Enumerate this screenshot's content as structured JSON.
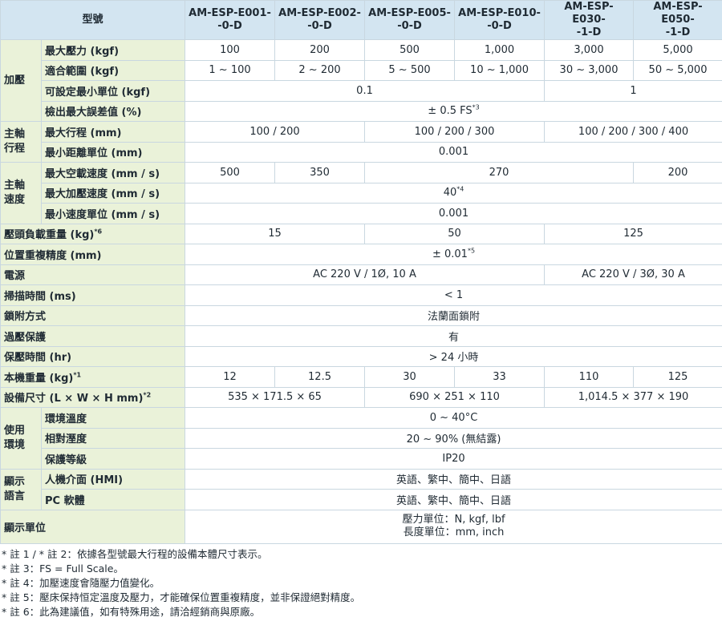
{
  "header": {
    "model_label": "型號",
    "models": [
      "AM-ESP-E001-\n-0-D",
      "AM-ESP-E002-\n-0-D",
      "AM-ESP-E005-\n-0-D",
      "AM-ESP-E010-\n-0-D",
      "AM-ESP-E030-\n-1-D",
      "AM-ESP-E050-\n-1-D"
    ]
  },
  "groups": {
    "pressure": "加壓",
    "stroke": "主軸\n行程",
    "speed": "主軸\n速度",
    "environment": "使用\n環境",
    "language": "顯示\n語言"
  },
  "rows": {
    "max_pressure": {
      "label": "最大壓力 (kgf)",
      "values": [
        "100",
        "200",
        "500",
        "1,000",
        "3,000",
        "5,000"
      ]
    },
    "range": {
      "label": "適合範圍 (kgf)",
      "values": [
        "1 ~ 100",
        "2 ~ 200",
        "5 ~ 500",
        "10 ~ 1,000",
        "30 ~ 3,000",
        "50 ~ 5,000"
      ]
    },
    "min_unit": {
      "label": "可設定最小單位 (kgf)",
      "values": [
        "0.1",
        "1"
      ]
    },
    "max_error": {
      "label": "檢出最大誤差值 (%)",
      "value": "± 0.5 FS",
      "sup": "*3"
    },
    "max_stroke": {
      "label": "最大行程 (mm)",
      "values": [
        "100 / 200",
        "100 / 200 / 300",
        "100 / 200 / 300 / 400"
      ]
    },
    "min_distance": {
      "label": "最小距離單位 (mm)",
      "value": "0.001"
    },
    "max_idle_speed": {
      "label": "最大空載速度 (mm / s)",
      "values": [
        "500",
        "350",
        "270",
        "200"
      ]
    },
    "max_press_speed": {
      "label": "最大加壓速度 (mm / s)",
      "value": "40",
      "sup": "*4"
    },
    "min_speed_unit": {
      "label": "最小速度單位 (mm / s)",
      "value": "0.001"
    },
    "head_load": {
      "label": "壓頭負載重量 (kg)",
      "label_sup": "*6",
      "values": [
        "15",
        "50",
        "125"
      ]
    },
    "repeatability": {
      "label": "位置重複精度 (mm)",
      "value": "± 0.01",
      "sup": "*5"
    },
    "power": {
      "label": "電源",
      "values": [
        "AC 220 V / 1Ø, 10 A",
        "AC 220 V / 3Ø, 30 A"
      ]
    },
    "scan_time": {
      "label": "掃描時間 (ms)",
      "value": "< 1"
    },
    "locking": {
      "label": "鎖附方式",
      "value": "法蘭面鎖附"
    },
    "overpressure": {
      "label": "過壓保護",
      "value": "有"
    },
    "hold_time": {
      "label": "保壓時間 (hr)",
      "value": "> 24 小時"
    },
    "weight": {
      "label": "本機重量 (kg)",
      "label_sup": "*1",
      "values": [
        "12",
        "12.5",
        "30",
        "33",
        "110",
        "125"
      ]
    },
    "dimensions": {
      "label": "設備尺寸 (L × W × H mm)",
      "label_sup": "*2",
      "values": [
        "535 × 171.5 × 65",
        "690 × 251 × 110",
        "1,014.5 × 377 × 190"
      ]
    },
    "env_temp": {
      "label": "環境溫度",
      "value": "0 ~ 40°C"
    },
    "humidity": {
      "label": "相對溼度",
      "value": "20 ~ 90% (無結露)"
    },
    "protection": {
      "label": "保護等級",
      "value": "IP20"
    },
    "hmi": {
      "label": "人機介面 (HMI)",
      "value": "英語、繁中、簡中、日語"
    },
    "pc_software": {
      "label": "PC 軟體",
      "value": "英語、繁中、簡中、日語"
    },
    "display_unit": {
      "label": "顯示單位",
      "value": "壓力單位：N, kgf, lbf\n長度單位：mm, inch"
    }
  },
  "notes": [
    "* 註 1 / * 註 2：依據各型號最大行程的設備本體尺寸表示。",
    "* 註 3：FS = Full Scale。",
    "* 註 4：加壓速度會隨壓力值變化。",
    "* 註 5：壓床保持恒定溫度及壓力，才能確保位置重複精度，並非保證絕對精度。",
    "* 註 6：此為建議值，如有特殊用途，請洽經銷商與原廠。"
  ]
}
